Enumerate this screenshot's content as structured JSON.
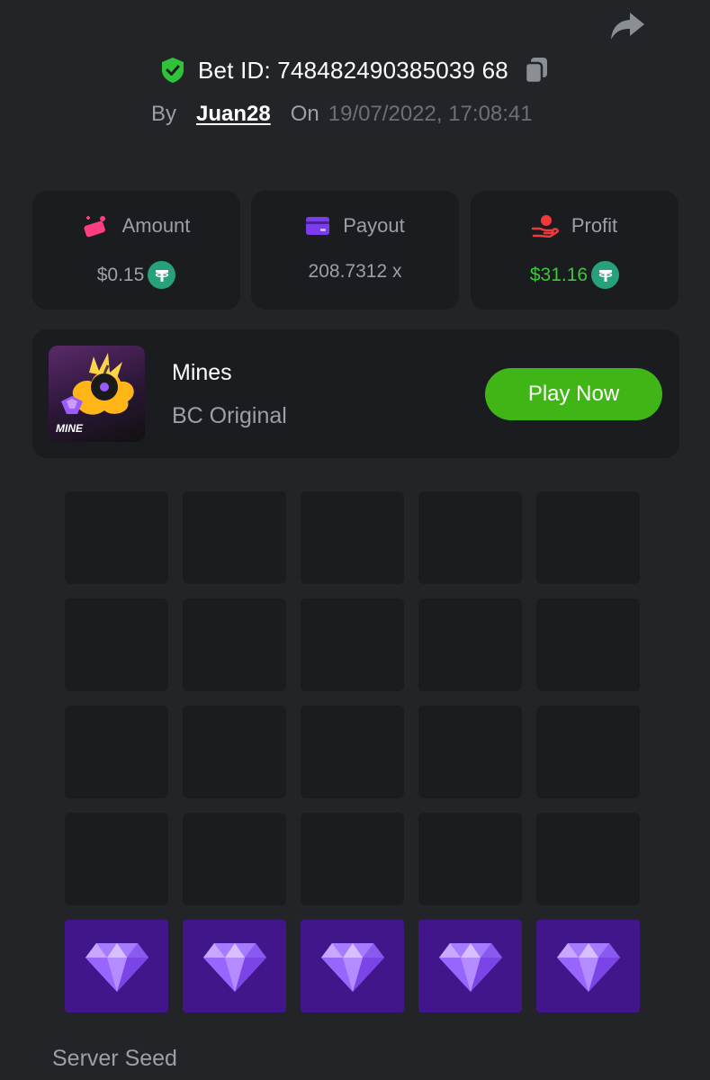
{
  "bet": {
    "id_label": "Bet ID: 748482490385039 68",
    "by_label": "By",
    "user": "Juan28",
    "on_label": "On",
    "date": "19/07/2022, 17:08:41"
  },
  "stats": [
    {
      "label": "Amount",
      "value": "$0.15",
      "icon": "amount-icon",
      "color": "#ff3d7f"
    },
    {
      "label": "Payout",
      "value": "208.7312 x",
      "icon": "card-icon",
      "color": "#7b3cf0"
    },
    {
      "label": "Profit",
      "value": "$31.16",
      "icon": "profit-icon",
      "color": "#ef3a3a"
    }
  ],
  "game": {
    "name": "Mines",
    "subtitle": "BC Original",
    "thumb_label": "MINE",
    "play_label": "Play Now"
  },
  "board": {
    "rows": 5,
    "cols": 5,
    "revealed_gems_row": 5,
    "tile_icon": "diamond-icon"
  },
  "section": {
    "server_seed_label": "Server Seed"
  },
  "colors": {
    "accent_green": "#3fb615",
    "gem_tile": "#41168a",
    "panel": "#1b1c1f",
    "background": "#232428"
  }
}
